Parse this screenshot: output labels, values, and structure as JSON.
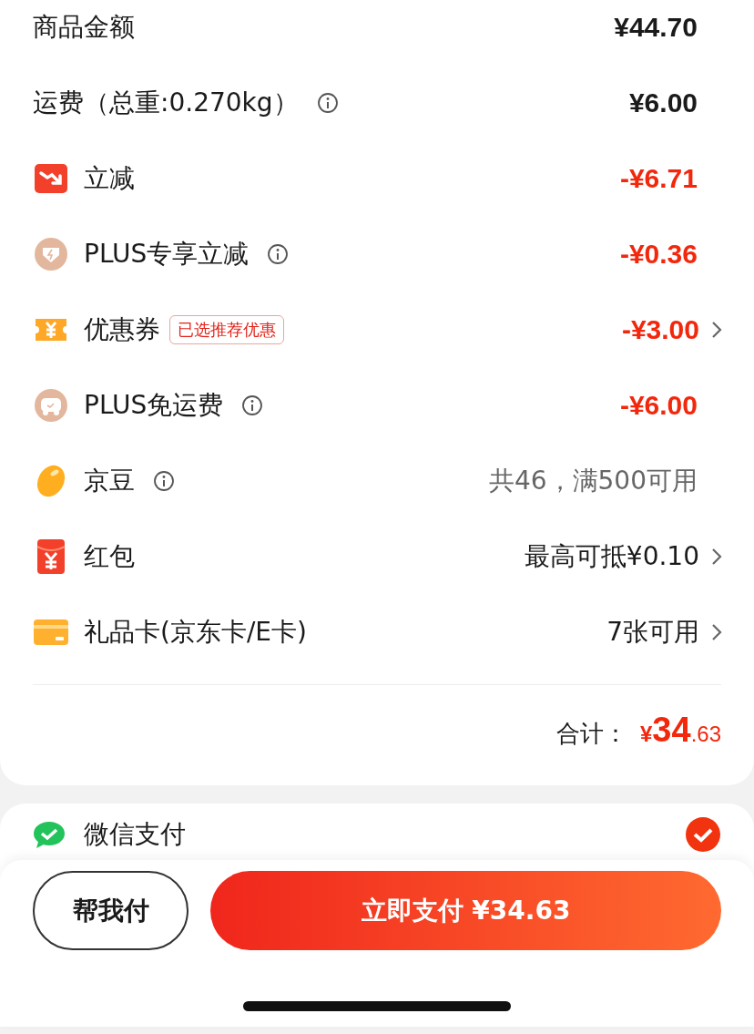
{
  "summary": {
    "rows": [
      {
        "kind": "price",
        "label": "商品金额",
        "info": false,
        "value": "¥44.70",
        "deduction": false,
        "disabled": false,
        "chevron": false
      },
      {
        "kind": "shipping",
        "label": "运费（总重:0.270kg）",
        "info": true,
        "value": "¥6.00",
        "deduction": false,
        "disabled": false,
        "chevron": false
      },
      {
        "kind": "instant-cut",
        "label": "立减",
        "info": false,
        "value": "-¥6.71",
        "deduction": true,
        "disabled": false,
        "chevron": false
      },
      {
        "kind": "plus-cut",
        "label": "PLUS专享立减",
        "info": true,
        "value": "-¥0.36",
        "deduction": true,
        "disabled": false,
        "chevron": false
      },
      {
        "kind": "coupon",
        "label": "优惠券",
        "badge": "已选推荐优惠",
        "info": false,
        "value": "-¥3.00",
        "deduction": true,
        "disabled": false,
        "chevron": true
      },
      {
        "kind": "plus-shipping",
        "label": "PLUS免运费",
        "info": true,
        "value": "-¥6.00",
        "deduction": true,
        "disabled": false,
        "chevron": false
      },
      {
        "kind": "beans",
        "label": "京豆",
        "info": true,
        "value": "共46，满500可用",
        "deduction": false,
        "disabled": true,
        "chevron": false
      },
      {
        "kind": "red-packet",
        "label": "红包",
        "info": false,
        "value": "最高可抵¥0.10",
        "deduction": false,
        "disabled": false,
        "chevron": true
      },
      {
        "kind": "gift-card",
        "label": "礼品卡(京东卡/E卡)",
        "info": false,
        "value": "7张可用",
        "deduction": false,
        "disabled": false,
        "chevron": true
      }
    ],
    "total": {
      "label": "合计：",
      "currency": "¥",
      "integer": "34",
      "decimal": ".63"
    }
  },
  "payment_methods": [
    {
      "label": "微信支付",
      "selected": true
    }
  ],
  "bottom_bar": {
    "help_button": "帮我付",
    "pay_button": "立即支付 ¥34.63"
  }
}
